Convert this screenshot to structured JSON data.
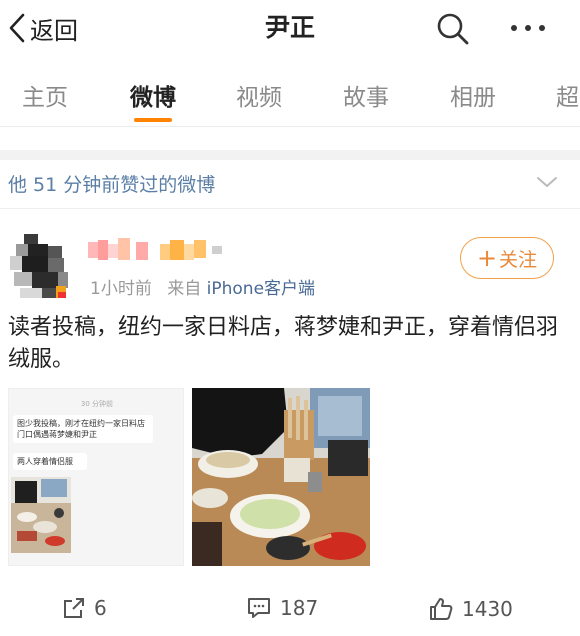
{
  "header": {
    "back_label": "返回",
    "title": "尹正"
  },
  "tabs": [
    {
      "label": "主页",
      "active": false
    },
    {
      "label": "微博",
      "active": true
    },
    {
      "label": "视频",
      "active": false
    },
    {
      "label": "故事",
      "active": false
    },
    {
      "label": "相册",
      "active": false
    },
    {
      "label": "超",
      "active": false
    }
  ],
  "liked_notice": "他 51 分钟前赞过的微博",
  "post": {
    "time": "1小时前",
    "source_prefix": "来自",
    "source": "iPhone客户端",
    "follow_label": "关注",
    "text": "读者投稿，纽约一家日料店，蒋梦婕和尹正，穿着情侣羽绒服。",
    "image1": {
      "time": "30 分钟前",
      "bubble1": "图少我投稿，刚才在纽约一家日料店门口偶遇蒋梦婕和尹正",
      "bubble2": "两人穿着情侣服"
    }
  },
  "actions": {
    "repost_count": "6",
    "comment_count": "187",
    "like_count": "1430"
  },
  "colors": {
    "accent": "#ff8200",
    "link": "#5b7fa6",
    "follow": "#e8893a"
  }
}
